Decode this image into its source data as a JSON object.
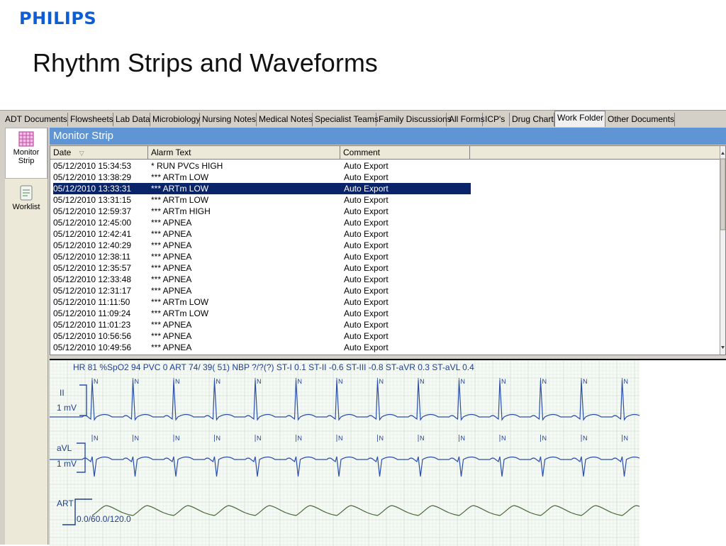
{
  "brand": {
    "logo_text": "PHILIPS"
  },
  "slide": {
    "title": "Rhythm Strips and Waveforms"
  },
  "tabs": [
    "ADT Documents",
    "Flowsheets",
    "Lab Data",
    "Microbiology",
    "Nursing Notes",
    "Medical Notes",
    "Specialist Teams",
    "Family Discussions",
    "All Forms",
    "ICP's",
    "Drug Chart",
    "Work Folder",
    "Other Documents"
  ],
  "active_tab": "Work Folder",
  "sidebar": {
    "items": [
      {
        "label": "Monitor Strip",
        "icon": "monitor-strip-icon"
      },
      {
        "label": "Worklist",
        "icon": "worklist-icon"
      }
    ]
  },
  "panel": {
    "title": "Monitor Strip"
  },
  "grid": {
    "columns": [
      "Date",
      "Alarm Text",
      "Comment"
    ],
    "selected_index": 2,
    "rows": [
      {
        "date": "05/12/2010 15:34:53",
        "alarm": "* RUN PVCs HIGH",
        "comment": "Auto Export"
      },
      {
        "date": "05/12/2010 13:38:29",
        "alarm": "*** ARTm   LOW",
        "comment": "Auto Export"
      },
      {
        "date": "05/12/2010 13:33:31",
        "alarm": "*** ARTm   LOW",
        "comment": "Auto Export"
      },
      {
        "date": "05/12/2010 13:31:15",
        "alarm": "*** ARTm   LOW",
        "comment": "Auto Export"
      },
      {
        "date": "05/12/2010 12:59:37",
        "alarm": "*** ARTm   HIGH",
        "comment": "Auto Export"
      },
      {
        "date": "05/12/2010 12:45:00",
        "alarm": "*** APNEA",
        "comment": "Auto Export"
      },
      {
        "date": "05/12/2010 12:42:41",
        "alarm": "*** APNEA",
        "comment": "Auto Export"
      },
      {
        "date": "05/12/2010 12:40:29",
        "alarm": "*** APNEA",
        "comment": "Auto Export"
      },
      {
        "date": "05/12/2010 12:38:11",
        "alarm": "*** APNEA",
        "comment": "Auto Export"
      },
      {
        "date": "05/12/2010 12:35:57",
        "alarm": "*** APNEA",
        "comment": "Auto Export"
      },
      {
        "date": "05/12/2010 12:33:48",
        "alarm": "*** APNEA",
        "comment": "Auto Export"
      },
      {
        "date": "05/12/2010 12:31:17",
        "alarm": "*** APNEA",
        "comment": "Auto Export"
      },
      {
        "date": "05/12/2010 11:11:50",
        "alarm": "*** ARTm   LOW",
        "comment": "Auto Export"
      },
      {
        "date": "05/12/2010 11:09:24",
        "alarm": "*** ARTm   LOW",
        "comment": "Auto Export"
      },
      {
        "date": "05/12/2010 11:01:23",
        "alarm": "*** APNEA",
        "comment": "Auto Export"
      },
      {
        "date": "05/12/2010 10:56:56",
        "alarm": "*** APNEA",
        "comment": "Auto Export"
      },
      {
        "date": "05/12/2010 10:49:56",
        "alarm": "*** APNEA",
        "comment": "Auto Export"
      }
    ]
  },
  "waveform": {
    "parameters": "HR 81   %SpO2 94   PVC 0   ART  74/ 39( 51)   NBP ?/?(?)   ST-I 0.1   ST-II -0.6   ST-III -0.8   ST-aVR 0.3   ST-aVL 0.4",
    "leads": [
      {
        "name": "II",
        "scale": "1 mV"
      },
      {
        "name": "aVL",
        "scale": "1 mV"
      },
      {
        "name": "ART",
        "scale": "0.0/60.0/120.0"
      }
    ],
    "beat_marker": "N",
    "colors": {
      "ecg": "#2a4fa8",
      "art": "#4a6a3a",
      "grid": "#cfe0cf"
    }
  },
  "colors": {
    "logo": "#0b5ed7",
    "header": "#5f95d4",
    "selection": "#0a246a"
  }
}
